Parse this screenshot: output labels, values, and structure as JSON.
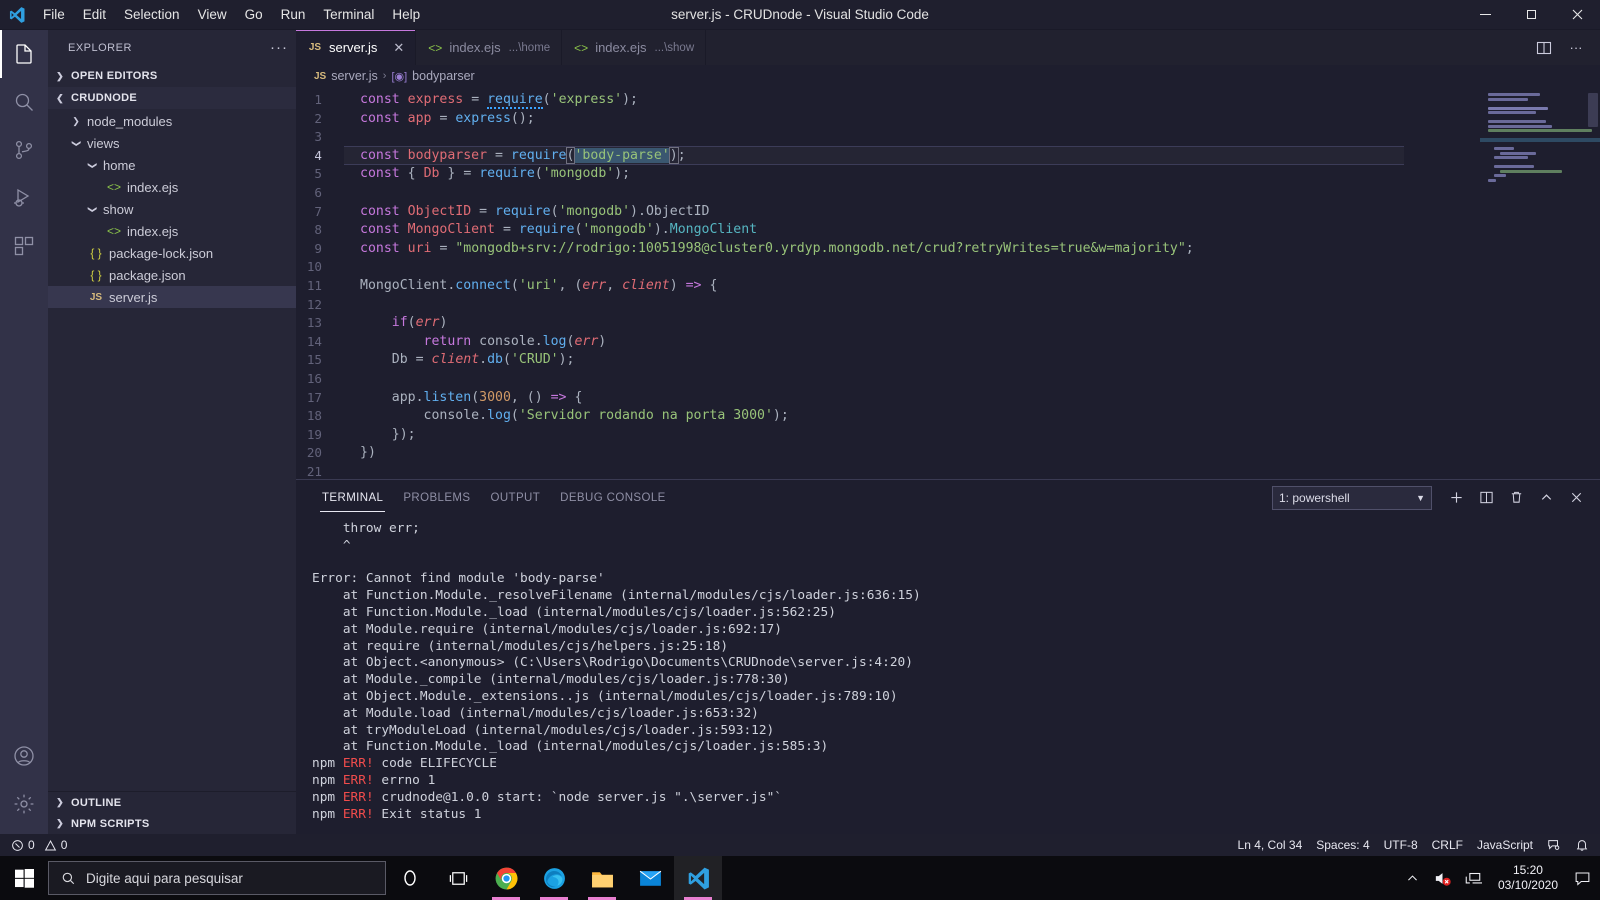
{
  "titlebar": {
    "window_title": "server.js - CRUDnode - Visual Studio Code",
    "menus": [
      "File",
      "Edit",
      "Selection",
      "View",
      "Go",
      "Run",
      "Terminal",
      "Help"
    ],
    "controls": {
      "minimize": "─",
      "maximize": "❑",
      "close": "✕"
    }
  },
  "activitybar": {
    "items": [
      {
        "name": "explorer",
        "icon": "files-icon",
        "active": true
      },
      {
        "name": "search",
        "icon": "search-icon",
        "active": false
      },
      {
        "name": "source-control",
        "icon": "source-control-icon",
        "active": false
      },
      {
        "name": "run-debug",
        "icon": "run-debug-icon",
        "active": false
      },
      {
        "name": "extensions",
        "icon": "extensions-icon",
        "active": false
      },
      {
        "name": "accounts",
        "icon": "account-icon",
        "active": false
      },
      {
        "name": "settings",
        "icon": "gear-icon",
        "active": false
      }
    ]
  },
  "sidebar": {
    "title": "EXPLORER",
    "more_actions": "···",
    "sections": {
      "open_editors": "OPEN EDITORS",
      "project": "CRUDNODE",
      "outline": "OUTLINE",
      "npm_scripts": "NPM SCRIPTS"
    },
    "tree": [
      {
        "label": "node_modules",
        "icon": "folder",
        "indent": 1,
        "expanded": false,
        "selected": false
      },
      {
        "label": "views",
        "icon": "folder",
        "indent": 1,
        "expanded": true,
        "selected": false
      },
      {
        "label": "home",
        "icon": "folder",
        "indent": 2,
        "expanded": true,
        "selected": false
      },
      {
        "label": "index.ejs",
        "icon": "ejs",
        "indent": 3,
        "selected": false
      },
      {
        "label": "show",
        "icon": "folder",
        "indent": 2,
        "expanded": true,
        "selected": false
      },
      {
        "label": "index.ejs",
        "icon": "ejs",
        "indent": 3,
        "selected": false
      },
      {
        "label": "package-lock.json",
        "icon": "json",
        "indent": 1,
        "selected": false
      },
      {
        "label": "package.json",
        "icon": "json",
        "indent": 1,
        "selected": false
      },
      {
        "label": "server.js",
        "icon": "js",
        "indent": 1,
        "selected": true
      }
    ]
  },
  "tabs": [
    {
      "label": "server.js",
      "suffix": "",
      "icon": "js",
      "active": true,
      "close": "✕"
    },
    {
      "label": "index.ejs",
      "suffix": "...\\home",
      "icon": "ejs",
      "active": false,
      "close": ""
    },
    {
      "label": "index.ejs",
      "suffix": "...\\show",
      "icon": "ejs",
      "active": false,
      "close": ""
    }
  ],
  "editor_actions": {
    "split": "split-editor-icon",
    "more": "···"
  },
  "breadcrumb": {
    "file": "server.js",
    "separator": "›",
    "symbol": "bodyparser"
  },
  "code": {
    "lines": [
      {
        "n": 1,
        "text": "const express = require('express');"
      },
      {
        "n": 2,
        "text": "const app = express();"
      },
      {
        "n": 3,
        "text": ""
      },
      {
        "n": 4,
        "text": "const bodyparser = require('body-parse');",
        "current": true
      },
      {
        "n": 5,
        "text": "const { Db } = require('mongodb');"
      },
      {
        "n": 6,
        "text": ""
      },
      {
        "n": 7,
        "text": "const ObjectID = require('mongodb').ObjectID"
      },
      {
        "n": 8,
        "text": "const MongoClient = require('mongodb').MongoClient"
      },
      {
        "n": 9,
        "text": "const uri = \"mongodb+srv://rodrigo:10051998@cluster0.yrdyp.mongodb.net/crud?retryWrites=true&w=majority\";"
      },
      {
        "n": 10,
        "text": ""
      },
      {
        "n": 11,
        "text": "MongoClient.connect('uri', (err, client) => {"
      },
      {
        "n": 12,
        "text": ""
      },
      {
        "n": 13,
        "text": "    if(err)"
      },
      {
        "n": 14,
        "text": "        return console.log(err)"
      },
      {
        "n": 15,
        "text": "    Db = client.db('CRUD');"
      },
      {
        "n": 16,
        "text": ""
      },
      {
        "n": 17,
        "text": "    app.listen(3000, () => {"
      },
      {
        "n": 18,
        "text": "        console.log('Servidor rodando na porta 3000');"
      },
      {
        "n": 19,
        "text": "    });"
      },
      {
        "n": 20,
        "text": "})"
      },
      {
        "n": 21,
        "text": ""
      }
    ],
    "selected_text": "body-parse"
  },
  "panel": {
    "tabs": [
      "TERMINAL",
      "PROBLEMS",
      "OUTPUT",
      "DEBUG CONSOLE"
    ],
    "active_tab": "TERMINAL",
    "terminal_select": "1: powershell",
    "actions": {
      "new": "+",
      "split": "split-terminal-icon",
      "kill": "trash-icon",
      "maximize": "⌃",
      "close": "✕"
    },
    "output": [
      {
        "text": "    throw err;"
      },
      {
        "text": "    ^"
      },
      {
        "text": ""
      },
      {
        "text": "Error: Cannot find module 'body-parse'"
      },
      {
        "text": "    at Function.Module._resolveFilename (internal/modules/cjs/loader.js:636:15)"
      },
      {
        "text": "    at Function.Module._load (internal/modules/cjs/loader.js:562:25)"
      },
      {
        "text": "    at Module.require (internal/modules/cjs/loader.js:692:17)"
      },
      {
        "text": "    at require (internal/modules/cjs/helpers.js:25:18)"
      },
      {
        "text": "    at Object.<anonymous> (C:\\Users\\Rodrigo\\Documents\\CRUDnode\\server.js:4:20)"
      },
      {
        "text": "    at Module._compile (internal/modules/cjs/loader.js:778:30)"
      },
      {
        "text": "    at Object.Module._extensions..js (internal/modules/cjs/loader.js:789:10)"
      },
      {
        "text": "    at Module.load (internal/modules/cjs/loader.js:653:32)"
      },
      {
        "text": "    at tryModuleLoad (internal/modules/cjs/loader.js:593:12)"
      },
      {
        "text": "    at Function.Module._load (internal/modules/cjs/loader.js:585:3)"
      },
      {
        "prefix": "npm ",
        "err": "ERR! ",
        "text": "code ELIFECYCLE"
      },
      {
        "prefix": "npm ",
        "err": "ERR! ",
        "text": "errno 1"
      },
      {
        "prefix": "npm ",
        "err": "ERR! ",
        "text": "crudnode@1.0.0 start: `node server.js \".\\server.js\"`"
      },
      {
        "prefix": "npm ",
        "err": "ERR! ",
        "text": "Exit status 1"
      }
    ]
  },
  "statusbar": {
    "errors": "0",
    "warnings": "0",
    "cursor_position": "Ln 4, Col 34",
    "indentation": "Spaces: 4",
    "encoding": "UTF-8",
    "eol": "CRLF",
    "language": "JavaScript",
    "feedback_icon": "feedback-icon",
    "bell_icon": "bell-icon"
  },
  "taskbar": {
    "search_placeholder": "Digite aqui para pesquisar",
    "apps": [
      {
        "name": "cortana",
        "running": false
      },
      {
        "name": "task-view",
        "running": false
      },
      {
        "name": "google-chrome",
        "running": true
      },
      {
        "name": "microsoft-edge",
        "running": true
      },
      {
        "name": "file-explorer",
        "running": true
      },
      {
        "name": "mail",
        "running": false
      },
      {
        "name": "visual-studio-code",
        "running": true,
        "active": true
      }
    ],
    "tray": {
      "time": "15:20",
      "date": "03/10/2020"
    }
  },
  "colors": {
    "accent": "#c678dd",
    "error": "#f14c4c",
    "editor_bg": "#1e1e2e",
    "sidebar_bg": "#262637",
    "activitybar_bg": "#323248"
  }
}
